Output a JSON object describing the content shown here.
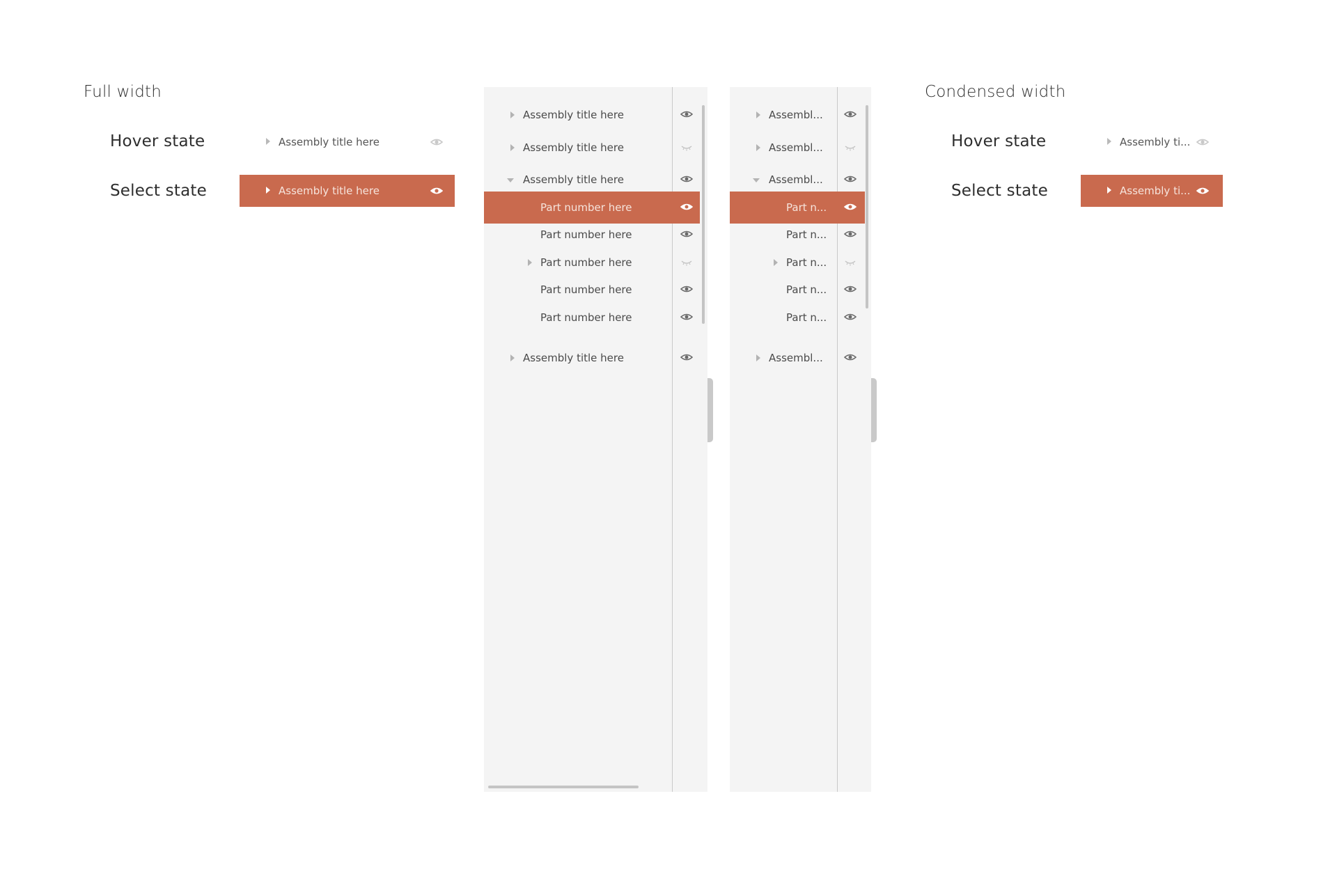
{
  "full_width": {
    "heading": "Full width",
    "hover_label": "Hover state",
    "select_label": "Select state",
    "hover_row_text": "Assembly title here",
    "select_row_text": "Assembly title here"
  },
  "condensed_width": {
    "heading": "Condensed width",
    "hover_label": "Hover state",
    "select_label": "Select state",
    "hover_row_text": "Assembly ti...",
    "select_row_text": "Assembly ti..."
  },
  "full_panel": {
    "rows": [
      {
        "text": "Assembly title here",
        "expander": "collapsed",
        "visibility": "visible"
      },
      {
        "text": "Assembly title here",
        "expander": "collapsed",
        "visibility": "hidden"
      },
      {
        "text": "Assembly title here",
        "expander": "expanded",
        "visibility": "visible"
      },
      {
        "text": "Part number here",
        "expander": "none",
        "visibility": "visible",
        "selected": true
      },
      {
        "text": "Part number here",
        "expander": "none",
        "visibility": "visible"
      },
      {
        "text": "Part number here",
        "expander": "collapsed",
        "visibility": "hidden"
      },
      {
        "text": "Part number here",
        "expander": "none",
        "visibility": "visible"
      },
      {
        "text": "Part number here",
        "expander": "none",
        "visibility": "visible"
      },
      {
        "text": "Assembly title here",
        "expander": "collapsed",
        "visibility": "visible"
      }
    ]
  },
  "condensed_panel": {
    "rows": [
      {
        "text": "Assembl...",
        "expander": "collapsed",
        "visibility": "visible"
      },
      {
        "text": "Assembl...",
        "expander": "collapsed",
        "visibility": "hidden"
      },
      {
        "text": "Assembl...",
        "expander": "expanded",
        "visibility": "visible"
      },
      {
        "text": "Part n...",
        "expander": "none",
        "visibility": "visible",
        "selected": true
      },
      {
        "text": "Part n...",
        "expander": "none",
        "visibility": "visible"
      },
      {
        "text": "Part n...",
        "expander": "collapsed",
        "visibility": "hidden"
      },
      {
        "text": "Part n...",
        "expander": "none",
        "visibility": "visible"
      },
      {
        "text": "Part n...",
        "expander": "none",
        "visibility": "visible"
      },
      {
        "text": "Assembl...",
        "expander": "collapsed",
        "visibility": "visible"
      }
    ]
  },
  "icons": {
    "visible": "eye-icon",
    "hidden": "eye-closed-icon",
    "collapsed": "caret-right-icon",
    "expanded": "caret-down-icon"
  },
  "colors": {
    "accent": "#c96a4e",
    "panel_bg": "#f4f4f4",
    "selected_text": "#f6e4dc"
  }
}
